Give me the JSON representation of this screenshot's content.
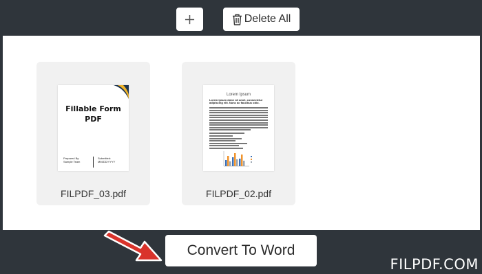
{
  "toolbar": {
    "add_icon": "plus-icon",
    "delete_icon": "trash-icon",
    "delete_label": "Delete All"
  },
  "files": [
    {
      "name": "FILPDF_03.pdf",
      "thumb": {
        "title": "Fillable Form PDF",
        "footer_left": [
          "Prepared By:",
          "Sample Team"
        ],
        "footer_right": [
          "Submitted:",
          "MM/DD/YYYY"
        ]
      }
    },
    {
      "name": "FILPDF_02.pdf",
      "thumb": {
        "title": "Lorem Ipsum",
        "subtitle": "Lorem ipsum dolor sit amet, consectetur adipiscing elit. Nunc ac faucibus odio."
      }
    }
  ],
  "convert_label": "Convert To Word",
  "brand": "FILPDF.COM",
  "colors": {
    "frame": "#2f353b",
    "workspace": "#ffffff",
    "card": "#f1f1f1",
    "arrow": "#d9332b",
    "thumb_accent": "#f0b429",
    "thumb_dark": "#1f3550"
  }
}
